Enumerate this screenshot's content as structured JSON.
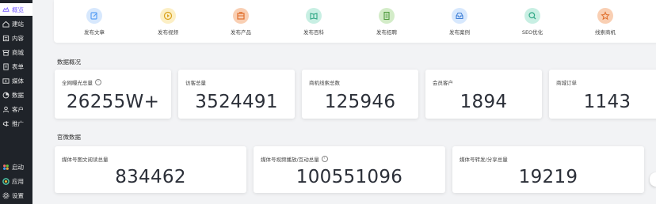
{
  "sidebar": {
    "items": [
      {
        "label": "概览",
        "icon": "dashboard-icon"
      },
      {
        "label": "建站",
        "icon": "home-icon"
      },
      {
        "label": "内容",
        "icon": "content-icon"
      },
      {
        "label": "商城",
        "icon": "shop-icon"
      },
      {
        "label": "表单",
        "icon": "form-icon"
      },
      {
        "label": "媒体",
        "icon": "media-icon"
      },
      {
        "label": "数据",
        "icon": "data-icon"
      },
      {
        "label": "客户",
        "icon": "customer-icon"
      },
      {
        "label": "推广",
        "icon": "promotion-icon"
      }
    ],
    "bottom_items": [
      {
        "label": "启动",
        "icon": "launch-icon"
      },
      {
        "label": "应用",
        "icon": "apps-icon"
      },
      {
        "label": "设置",
        "icon": "settings-icon"
      }
    ]
  },
  "quick_actions": [
    {
      "label": "发布文章",
      "icon": "edit-icon",
      "color": "#5aa0f5"
    },
    {
      "label": "发布视频",
      "icon": "play-icon",
      "color": "#f5c23a"
    },
    {
      "label": "发布产品",
      "icon": "box-icon",
      "color": "#f08a4b"
    },
    {
      "label": "发布百科",
      "icon": "book-icon",
      "color": "#4fc9a8"
    },
    {
      "label": "发布招聘",
      "icon": "document-icon",
      "color": "#79c36a"
    },
    {
      "label": "发布案例",
      "icon": "inbox-icon",
      "color": "#5aa0f5"
    },
    {
      "label": "SEO优化",
      "icon": "search-icon",
      "color": "#4fc9a8"
    },
    {
      "label": "线索商机",
      "icon": "star-icon",
      "color": "#f08a4b"
    }
  ],
  "overview": {
    "title": "数据概况",
    "stats": [
      {
        "label": "全网曝光总量",
        "value": "26255W+",
        "info": true
      },
      {
        "label": "访客总量",
        "value": "3524491",
        "info": false
      },
      {
        "label": "商机线索总数",
        "value": "125946",
        "info": false
      },
      {
        "label": "会员客户",
        "value": "1894",
        "info": false
      },
      {
        "label": "商城订单",
        "value": "1143",
        "info": false
      }
    ]
  },
  "official": {
    "title": "官微数据",
    "stats": [
      {
        "label": "媒体号图文阅读总量",
        "value": "834462",
        "info": false
      },
      {
        "label": "媒体号视频播放/互动总量",
        "value": "100551096",
        "info": true
      },
      {
        "label": "媒体号转发/分享总量",
        "value": "19219",
        "info": false
      }
    ]
  },
  "colors": {
    "sidebar_bg": "#1f2329",
    "active_accent": "#7b61ff",
    "page_bg": "#f2f3f5"
  }
}
